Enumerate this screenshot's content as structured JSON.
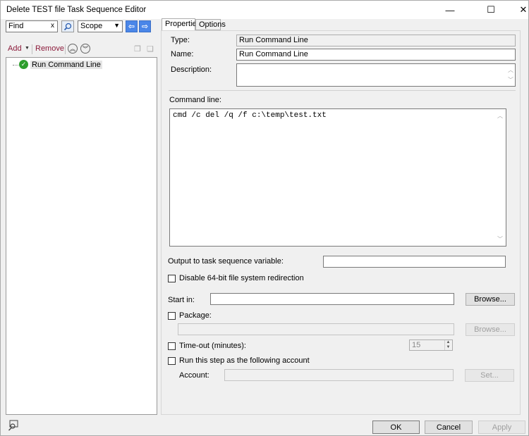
{
  "window": {
    "title": "Delete TEST file Task Sequence Editor",
    "minimize_glyph": "—",
    "maximize_glyph": "☐",
    "close_glyph": "✕"
  },
  "left_toolbar": {
    "find_value": "Find",
    "find_clear": "x",
    "scope_value": "Scope",
    "add_label": "Add",
    "remove_label": "Remove"
  },
  "tree": {
    "items": [
      {
        "label": "Run Command Line",
        "status": "success"
      }
    ]
  },
  "tabs": [
    {
      "label": "Properties",
      "active": true
    },
    {
      "label": "Options",
      "active": false
    }
  ],
  "properties": {
    "type_label": "Type:",
    "type_value": "Run Command Line",
    "name_label": "Name:",
    "name_value": "Run Command Line",
    "description_label": "Description:",
    "description_value": "",
    "command_line_label": "Command line:",
    "command_line_value": "cmd /c del /q /f c:\\temp\\test.txt",
    "output_variable_label": "Output to task sequence variable:",
    "output_variable_value": "",
    "disable_redirection_label": "Disable 64-bit file system redirection",
    "disable_redirection_checked": false,
    "start_in_label": "Start in:",
    "start_in_value": "",
    "browse_label": "Browse...",
    "package_label": "Package:",
    "package_checked": false,
    "package_value": "",
    "package_browse_label": "Browse...",
    "timeout_label": "Time-out (minutes):",
    "timeout_checked": false,
    "timeout_value": "15",
    "run_as_label": "Run this step as the following account",
    "run_as_checked": false,
    "account_label": "Account:",
    "account_value": "",
    "set_label": "Set..."
  },
  "footer": {
    "ok_label": "OK",
    "cancel_label": "Cancel",
    "apply_label": "Apply"
  },
  "colors": {
    "accent_blue": "#4a86e8",
    "success_green": "#2e9e2e",
    "toolbar_text": "#8b1a3a"
  }
}
